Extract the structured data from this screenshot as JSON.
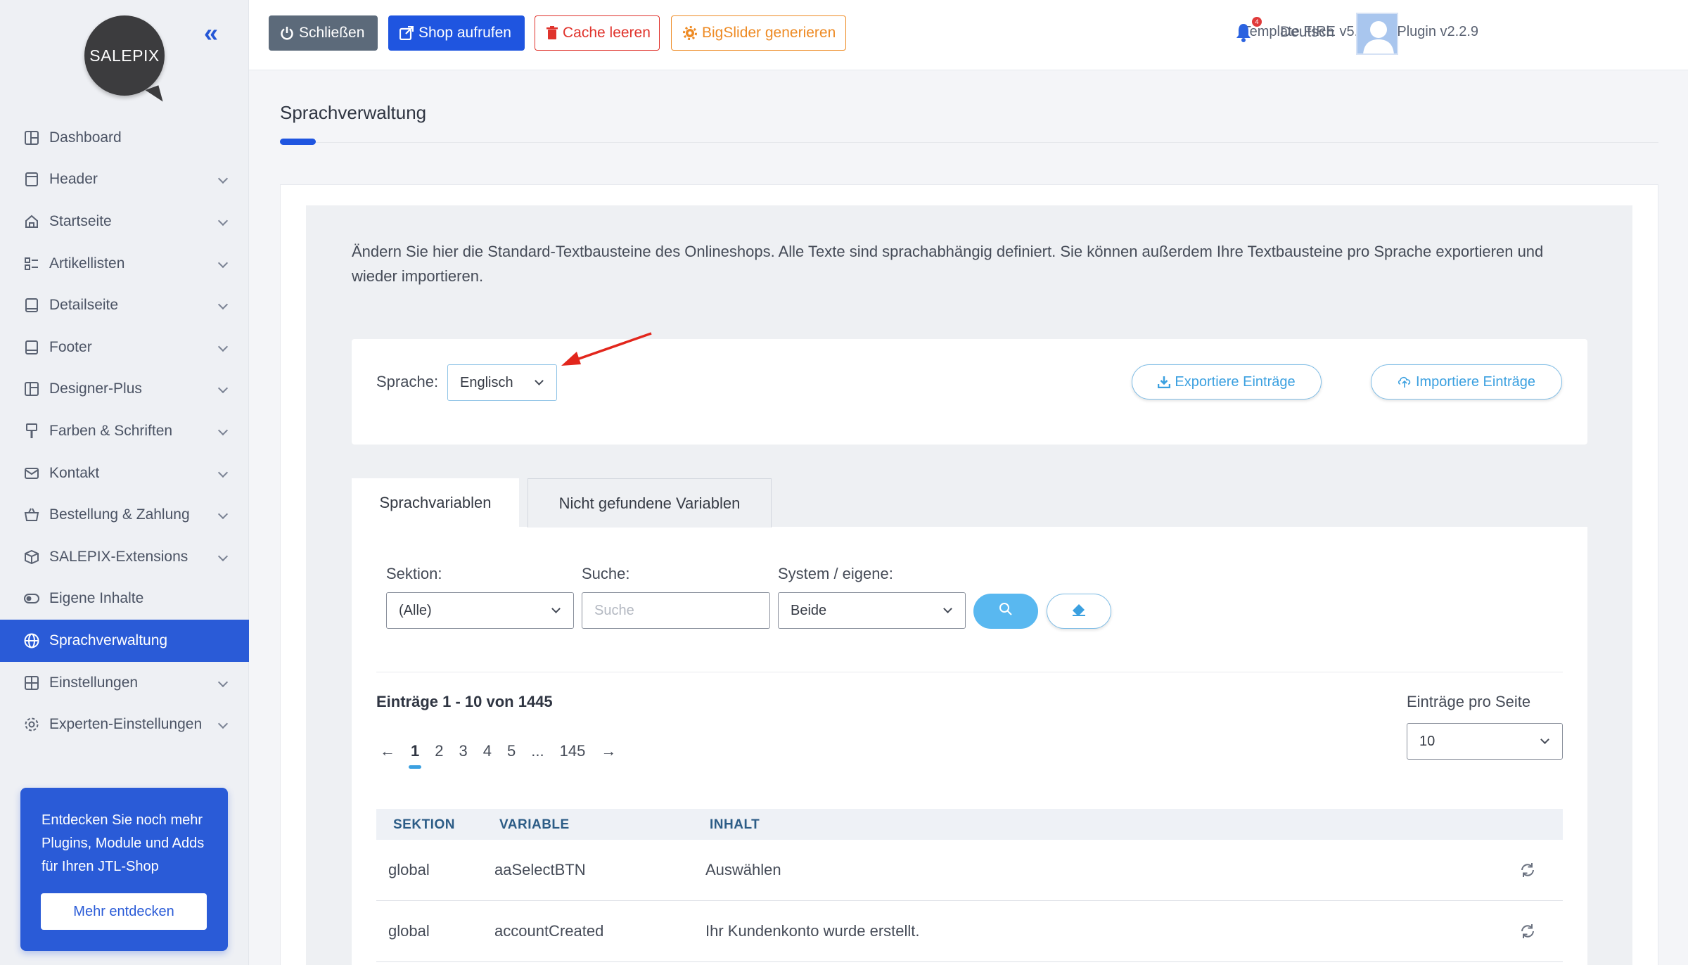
{
  "sidebar": {
    "logo_text": "SALEPIX",
    "items": [
      {
        "label": "Dashboard"
      },
      {
        "label": "Header"
      },
      {
        "label": "Startseite"
      },
      {
        "label": "Artikellisten"
      },
      {
        "label": "Detailseite"
      },
      {
        "label": "Footer"
      },
      {
        "label": "Designer-Plus"
      },
      {
        "label": "Farben & Schriften"
      },
      {
        "label": "Kontakt"
      },
      {
        "label": "Bestellung & Zahlung"
      },
      {
        "label": "SALEPIX-Extensions"
      },
      {
        "label": "Eigene Inhalte"
      },
      {
        "label": "Sprachverwaltung"
      },
      {
        "label": "Einstellungen"
      },
      {
        "label": "Experten-Einstellungen"
      }
    ],
    "promo": {
      "text": "Entdecken Sie noch mehr Plugins, Module und Adds für Ihren JTL-Shop",
      "button": "Mehr entdecken"
    }
  },
  "topbar": {
    "close_label": "Schließen",
    "shop_label": "Shop aufrufen",
    "cache_label": "Cache leeren",
    "slider_label": "BigSlider generieren",
    "version": "Template FIRE v5.2.46 | Plugin v2.2.9",
    "notification_count": "4",
    "language": "Deutsch"
  },
  "main": {
    "title": "Sprachverwaltung",
    "intro": "Ändern Sie hier die Standard-Textbausteine des Onlineshops. Alle Texte sind sprachabhängig definiert. Sie können außerdem Ihre Textbausteine pro Sprache exportieren und wieder importieren.",
    "language_label": "Sprache:",
    "language_value": "Englisch",
    "export_label": "Exportiere Einträge",
    "import_label": "Importiere Einträge",
    "tabs": [
      {
        "label": "Sprachvariablen"
      },
      {
        "label": "Nicht gefundene Variablen"
      }
    ],
    "filters": {
      "section_label": "Sektion:",
      "section_value": "(Alle)",
      "search_label": "Suche:",
      "search_placeholder": "Suche",
      "system_label": "System / eigene:",
      "system_value": "Beide"
    },
    "entries_info": "Einträge 1 - 10 von 1445",
    "per_page_label": "Einträge pro Seite",
    "per_page_value": "10",
    "pagination": {
      "prev": "←",
      "pages": [
        "1",
        "2",
        "3",
        "4",
        "5",
        "...",
        "145"
      ],
      "next": "→"
    },
    "table": {
      "headers": [
        "SEKTION",
        "VARIABLE",
        "INHALT"
      ],
      "rows": [
        {
          "section": "global",
          "variable": "aaSelectBTN",
          "content": "Auswählen"
        },
        {
          "section": "global",
          "variable": "accountCreated",
          "content": "Ihr Kundenkonto wurde erstellt."
        }
      ]
    }
  },
  "colors": {
    "primary": "#1f55e0",
    "sidebar_active": "#2a5bd7",
    "danger": "#e0332c",
    "warning": "#ee8b25",
    "info": "#3ba0e0"
  }
}
